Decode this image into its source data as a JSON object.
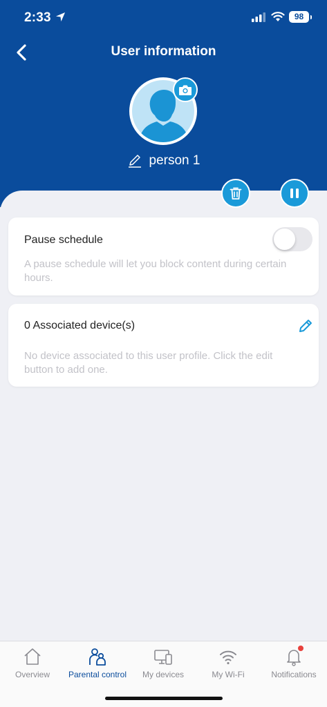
{
  "status_bar": {
    "time": "2:33",
    "battery": "98"
  },
  "header": {
    "title": "User information",
    "name": "person 1"
  },
  "pause_card": {
    "title": "Pause schedule",
    "description": "A pause schedule will let you block content during certain hours.",
    "enabled": false
  },
  "devices_card": {
    "title": "0 Associated device(s)",
    "description": "No device associated to this user profile. Click the edit button to add one."
  },
  "tabs": [
    {
      "label": "Overview",
      "icon": "home-icon",
      "active": false
    },
    {
      "label": "Parental control",
      "icon": "family-icon",
      "active": true
    },
    {
      "label": "My devices",
      "icon": "devices-icon",
      "active": false
    },
    {
      "label": "My Wi-Fi",
      "icon": "wifi-icon",
      "active": false
    },
    {
      "label": "Notifications",
      "icon": "bell-icon",
      "active": false,
      "badge": true
    }
  ],
  "colors": {
    "header": "#0a4c9c",
    "accent": "#1a9ad9",
    "background": "#eff0f5"
  }
}
